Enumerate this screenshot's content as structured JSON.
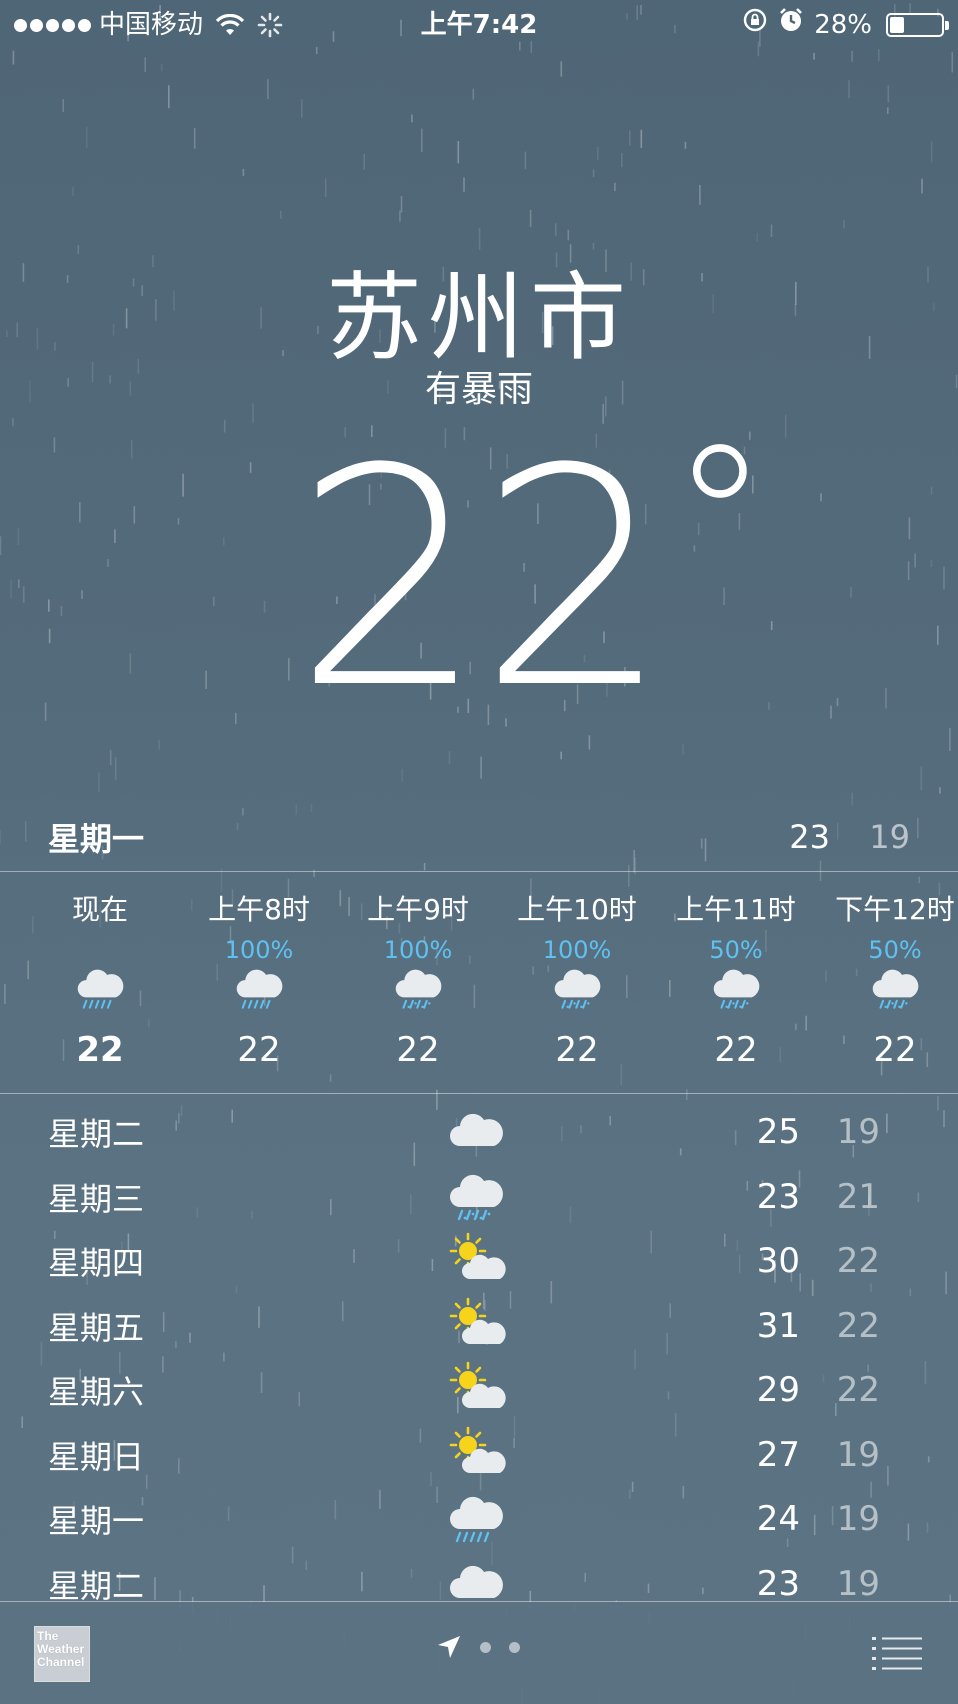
{
  "status_bar": {
    "carrier": "中国移动",
    "time": "上午7:42",
    "battery_percent": "28%",
    "battery_level": 0.28
  },
  "location": {
    "city": "苏州市",
    "condition": "有暴雨",
    "current_temp": "22",
    "degree_symbol": "°"
  },
  "today": {
    "day": "星期一",
    "high": "23",
    "low": "19"
  },
  "hourly": [
    {
      "label": "现在",
      "precip": "",
      "icon": "rain-cloud-icon",
      "temp": "22"
    },
    {
      "label": "上午8时",
      "precip": "100%",
      "icon": "rain-cloud-icon",
      "temp": "22"
    },
    {
      "label": "上午9时",
      "precip": "100%",
      "icon": "drizzle-cloud-icon",
      "temp": "22"
    },
    {
      "label": "上午10时",
      "precip": "100%",
      "icon": "drizzle-cloud-icon",
      "temp": "22"
    },
    {
      "label": "上午11时",
      "precip": "50%",
      "icon": "drizzle-cloud-icon",
      "temp": "22"
    },
    {
      "label": "下午12时",
      "precip": "50%",
      "icon": "drizzle-cloud-icon",
      "temp": "22"
    }
  ],
  "daily": [
    {
      "day": "星期二",
      "icon": "cloud-icon",
      "high": "25",
      "low": "19"
    },
    {
      "day": "星期三",
      "icon": "drizzle-cloud-icon",
      "high": "23",
      "low": "21"
    },
    {
      "day": "星期四",
      "icon": "partly-sunny-icon",
      "high": "30",
      "low": "22"
    },
    {
      "day": "星期五",
      "icon": "partly-sunny-icon",
      "high": "31",
      "low": "22"
    },
    {
      "day": "星期六",
      "icon": "partly-sunny-icon",
      "high": "29",
      "low": "22"
    },
    {
      "day": "星期日",
      "icon": "partly-sunny-icon",
      "high": "27",
      "low": "19"
    },
    {
      "day": "星期一",
      "icon": "rain-cloud-icon",
      "high": "24",
      "low": "19"
    },
    {
      "day": "星期二",
      "icon": "cloud-icon",
      "high": "23",
      "low": "19"
    }
  ],
  "footer": {
    "logo_line1": "The",
    "logo_line2": "Weather",
    "logo_line3": "Channel"
  },
  "colors": {
    "precip": "#5fc1f1",
    "sun": "#f6d41c",
    "background": "#546b7b"
  }
}
